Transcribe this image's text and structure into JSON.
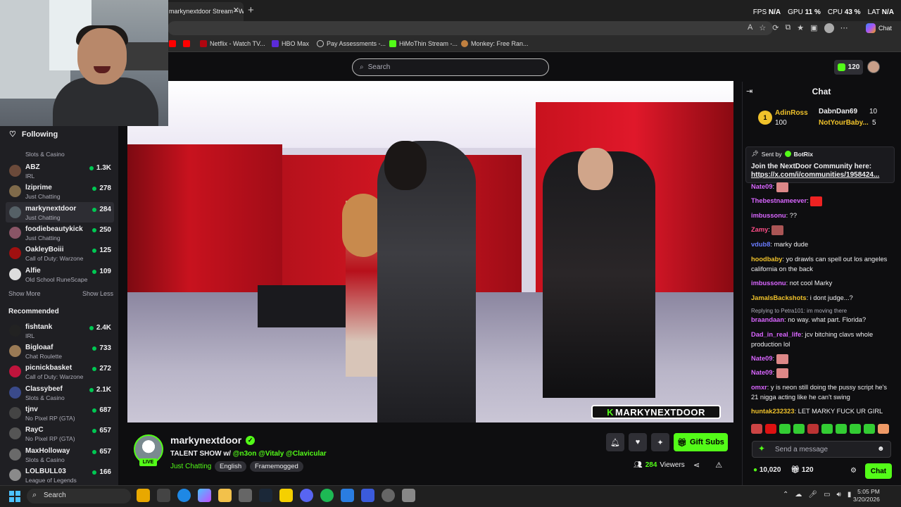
{
  "browser": {
    "tab_title": "markynextdoor Stream - Watch",
    "perf": [
      {
        "label": "FPS",
        "value": "N/A"
      },
      {
        "label": "GPU",
        "value": "11 %"
      },
      {
        "label": "CPU",
        "value": "43 %"
      },
      {
        "label": "LAT",
        "value": "N/A"
      }
    ],
    "copilot_label": "Chat",
    "bookmarks": [
      "Netflix - Watch TV...",
      "HBO Max",
      "Pay Assessments -...",
      "HiMoThin Stream -...",
      "Monkey: Free Ran..."
    ]
  },
  "site": {
    "search_placeholder": "Search",
    "points": "120"
  },
  "sidebar": {
    "following_label": "Following",
    "top_partial_game": "Slots & Casino",
    "following": [
      {
        "name": "ABZ",
        "game": "IRL",
        "viewers": "1.3K",
        "color": "#6b4a3a"
      },
      {
        "name": "lziprime",
        "game": "Just Chatting",
        "viewers": "278",
        "color": "#7f6a4a"
      },
      {
        "name": "markynextdoor",
        "game": "Just Chatting",
        "viewers": "284",
        "color": "#556066"
      },
      {
        "name": "foodiebeautykick",
        "game": "Just Chatting",
        "viewers": "250",
        "color": "#8a5566"
      },
      {
        "name": "OakleyBoiii",
        "game": "Call of Duty: Warzone",
        "viewers": "125",
        "color": "#a01010"
      },
      {
        "name": "Alfie",
        "game": "Old School RuneScape",
        "viewers": "109",
        "color": "#ddd"
      }
    ],
    "show_more": "Show More",
    "show_less": "Show Less",
    "recommended_label": "Recommended",
    "recommended": [
      {
        "name": "fishtank",
        "game": "IRL",
        "viewers": "2.4K",
        "color": "#222"
      },
      {
        "name": "Bigloaaf",
        "game": "Chat Roulette",
        "viewers": "733",
        "color": "#9a7a55"
      },
      {
        "name": "picnickbasket",
        "game": "Call of Duty: Warzone",
        "viewers": "272",
        "color": "#c0143c"
      },
      {
        "name": "Classybeef",
        "game": "Slots & Casino",
        "viewers": "2.1K",
        "color": "#3a4a8a"
      },
      {
        "name": "tjnv",
        "game": "No Pixel RP (GTA)",
        "viewers": "687",
        "color": "#444"
      },
      {
        "name": "RayC",
        "game": "No Pixel RP (GTA)",
        "viewers": "657",
        "color": "#555"
      },
      {
        "name": "MaxHolloway",
        "game": "Slots & Casino",
        "viewers": "657",
        "color": "#6a6a6a"
      },
      {
        "name": "LOLBULL03",
        "game": "League of Legends",
        "viewers": "166",
        "color": "#8a8a8a"
      }
    ]
  },
  "video": {
    "watermark": "MARKYNEXTDOOR"
  },
  "stream": {
    "channel": "markynextdoor",
    "live_badge": "LIVE",
    "title_prefix": "TALENT SHOW w/ ",
    "title_mentions": "@n3on @Vitaly @Clavicular",
    "category": "Just Chatting",
    "tags": [
      "English",
      "Framemogged"
    ],
    "gift_label": "Gift Subs",
    "viewers": "284",
    "viewers_label": "Viewers"
  },
  "chat": {
    "header": "Chat",
    "leaderboard": [
      {
        "rank": "1",
        "name": "AdinRoss",
        "amount": "100"
      },
      {
        "name": "DabnDan69",
        "amount": "10"
      },
      {
        "name": "NotYourBaby...",
        "amount": "5"
      }
    ],
    "pinned": {
      "sent_by": "Sent by",
      "sender": "BotRix",
      "message": "Join the NextDoor Community here:",
      "link": "https://x.com/i/communities/1958424..."
    },
    "messages": [
      {
        "user": "Nate09",
        "text": "",
        "color": "#d966ff",
        "emote": true
      },
      {
        "user": "Thebestnameever",
        "text": "",
        "color": "#d966ff",
        "emote": true
      },
      {
        "user": "imbussonu",
        "text": "??",
        "color": "#d966ff"
      },
      {
        "user": "Zamy",
        "text": "",
        "color": "#ff4d88",
        "emote": true
      },
      {
        "user": "vdub8",
        "text": "marky dude",
        "color": "#6a7cff"
      },
      {
        "user": "hoodbaby",
        "text": "yo drawls can spell out los angeles california on the back",
        "color": "#f0c22b"
      },
      {
        "user": "imbussonu",
        "text": "not cool Marky",
        "color": "#d966ff"
      },
      {
        "user": "JamalsBackshots",
        "text": "i dont judge...?",
        "color": "#f0c22b"
      },
      {
        "reply": "Replying to Petra101: im moving there",
        "user": "braandaan",
        "text": "no way. what part. Florida?",
        "color": "#d966ff"
      },
      {
        "user": "Dad_in_real_life",
        "text": "jcv bitching clavs whole production lol",
        "color": "#d966ff"
      },
      {
        "user": "Nate09",
        "text": "",
        "color": "#d966ff",
        "emote": true
      },
      {
        "user": "Nate09",
        "text": "",
        "color": "#d966ff",
        "emote": true
      },
      {
        "user": "omxr",
        "text": "y is neon still doing the pussy script he's 21 nigga acting like he can't swing",
        "color": "#d966ff"
      },
      {
        "user": "huntak232323",
        "text": "LET MARKY FUCK UR GIRL",
        "color": "#f0c22b"
      }
    ],
    "input_placeholder": "Send a message",
    "footer_points": "10,020",
    "footer_subs": "120",
    "chat_button": "Chat"
  },
  "taskbar": {
    "search_label": "Search",
    "time": "5:05 PM",
    "date": "3/20/2026"
  }
}
